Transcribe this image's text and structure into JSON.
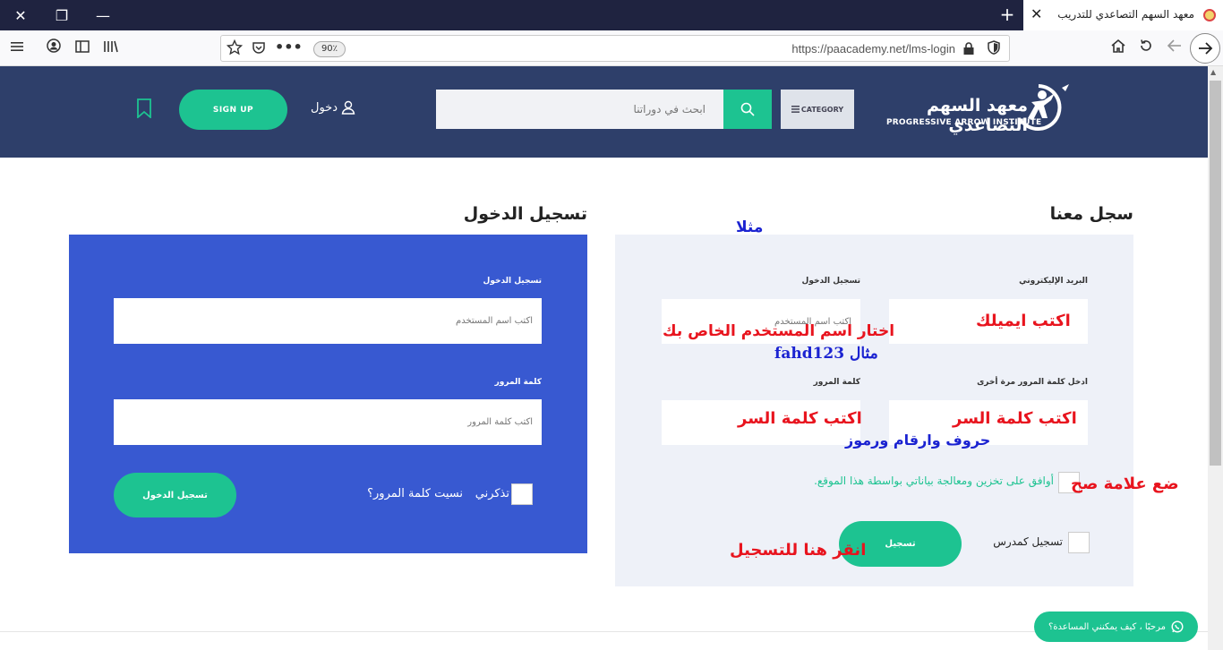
{
  "browser": {
    "tab_title": "معهد السهم التصاعدي للتدريب",
    "url": "https://paacademy.net/lms-login",
    "zoom": "90٪",
    "close_symbol": "✕",
    "restore_symbol": "❐",
    "minimize_symbol": "—",
    "newtab_symbol": "+",
    "tab_close_symbol": "✕"
  },
  "header": {
    "logo_arabic": "معهد السهم التصاعدي",
    "logo_english": "PROGRESSIVE ARROW INSTITUTE",
    "category_label": "CATEGORY",
    "search_placeholder": "ابحث في دوراتنا",
    "login_label": "دخول",
    "signup_label": "SIGN UP"
  },
  "register": {
    "title": "سجل معنا",
    "email_label": "البريد الإليكتروني",
    "username_label": "تسجيل الدخول",
    "username_placeholder": "اكتب اسم المستخدم",
    "confirm_password_label": "ادخل كلمة المرور مرة أخرى",
    "password_label": "كلمة المرور",
    "consent_text": "أوافق على تخزين ومعالجة بياناتي بواسطة هذا الموقع.",
    "instructor_label": "تسجيل كمدرس",
    "submit_label": "تسجيل"
  },
  "login": {
    "title": "تسجيل الدخول",
    "username_label": "تسجيل الدخول",
    "username_placeholder": "اكتب اسم المستخدم",
    "password_label": "كلمة المرور",
    "password_placeholder": "اكتب كلمة المرور",
    "remember_label": "تذكرني",
    "forgot_label": "نسيت كلمة المرور؟",
    "submit_label": "تسجيل الدخول"
  },
  "annotations": {
    "example_top": "مثلا",
    "write_email": "اكتب ايميلك",
    "choose_username": "اختار اسم المستخدم الخاص بك",
    "example_username": "مثال  fahd123",
    "write_password_1": "اكتب كلمة السر",
    "write_password_2": "اكتب كلمة السر",
    "password_hint": "حروف وارقام ورموز",
    "check_box": "ضع علامة صح",
    "click_to_register": "انقر هنا للتسجيل"
  },
  "chat": {
    "label": "مرحبًا ، كيف يمكنني المساعدة؟"
  },
  "colors": {
    "header_bg": "#2e3f6a",
    "accent_green": "#1dc391",
    "login_panel": "#3859d1",
    "register_panel": "#eef1f8"
  }
}
